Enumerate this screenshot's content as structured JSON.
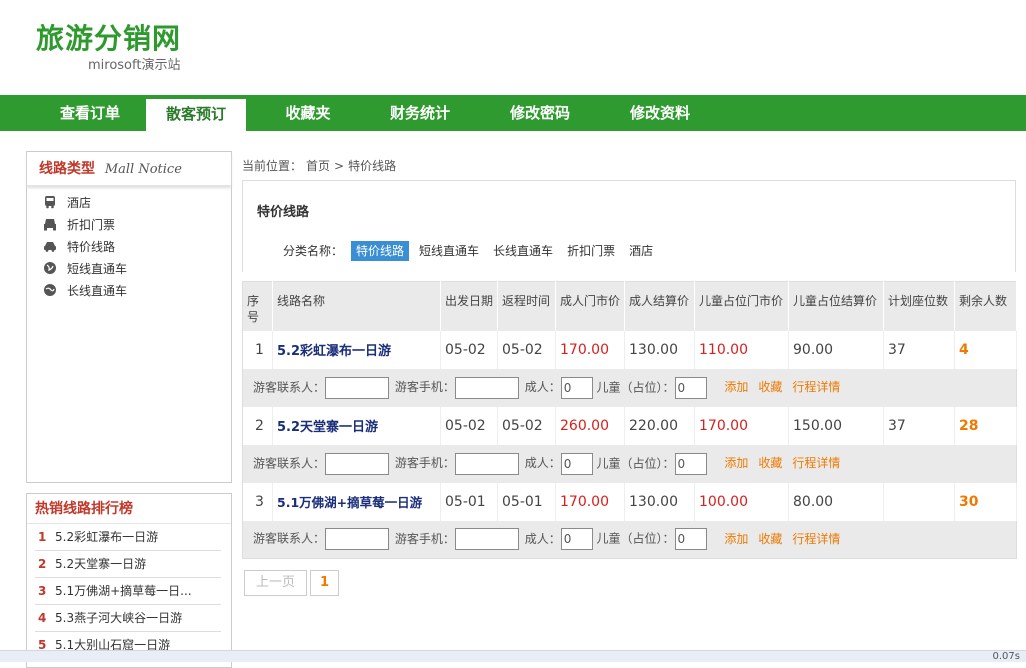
{
  "brand": {
    "title": "旅游分销网",
    "subtitle": "mirosoft演示站"
  },
  "nav": [
    {
      "label": "查看订单"
    },
    {
      "label": "散客预订"
    },
    {
      "label": "收藏夹"
    },
    {
      "label": "财务统计"
    },
    {
      "label": "修改密码"
    },
    {
      "label": "修改资料"
    }
  ],
  "sidebar": {
    "title": "线路类型",
    "title_en": "Mall Notice",
    "categories": [
      {
        "label": "酒店",
        "icon": "bus-icon"
      },
      {
        "label": "折扣门票",
        "icon": "car-icon"
      },
      {
        "label": "特价线路",
        "icon": "car-front-icon"
      },
      {
        "label": "短线直通车",
        "icon": "globe-icon"
      },
      {
        "label": "长线直通车",
        "icon": "globe-icon"
      }
    ],
    "rank_title": "热销线路排行榜",
    "ranking": [
      {
        "n": "1",
        "label": "5.2彩虹瀑布一日游"
      },
      {
        "n": "2",
        "label": "5.2天堂寨一日游"
      },
      {
        "n": "3",
        "label": "5.1万佛湖+摘草莓一日..."
      },
      {
        "n": "4",
        "label": "5.3燕子河大峡谷一日游"
      },
      {
        "n": "5",
        "label": "5.1大别山石窟一日游"
      }
    ]
  },
  "breadcrumb": {
    "prefix": "当前位置：",
    "home": "首页",
    "sep": ">",
    "current": "特价线路"
  },
  "main": {
    "title": "特价线路",
    "filter_label": "分类名称：",
    "filters": [
      "特价线路",
      "短线直通车",
      "长线直通车",
      "折扣门票",
      "酒店"
    ]
  },
  "table": {
    "headers": [
      "序号",
      "线路名称",
      "出发日期",
      "返程时间",
      "成人门市价",
      "成人结算价",
      "儿童占位门市价",
      "儿童占位结算价",
      "计划座位数",
      "剩余人数"
    ],
    "rows": [
      {
        "no": "1",
        "name": "5.2彩虹瀑布一日游",
        "depart": "05-02",
        "return": "05-02",
        "adult_market": "170.00",
        "adult_settle": "130.00",
        "child_market": "110.00",
        "child_settle": "90.00",
        "seats": "37",
        "remain": "4"
      },
      {
        "no": "2",
        "name": "5.2天堂寨一日游",
        "depart": "05-02",
        "return": "05-02",
        "adult_market": "260.00",
        "adult_settle": "220.00",
        "child_market": "170.00",
        "child_settle": "150.00",
        "seats": "37",
        "remain": "28"
      },
      {
        "no": "3",
        "name": "5.1万佛湖+摘草莓一日游",
        "depart": "05-01",
        "return": "05-01",
        "adult_market": "170.00",
        "adult_settle": "130.00",
        "child_market": "100.00",
        "child_settle": "80.00",
        "seats": "",
        "remain": "30"
      }
    ],
    "form": {
      "contact_label": "游客联系人：",
      "phone_label": "游客手机：",
      "adult_label": "成人：",
      "child_label": "儿童（占位）：",
      "adult_value": "0",
      "child_value": "0",
      "add": "添加",
      "fav": "收藏",
      "detail": "行程详情"
    }
  },
  "pager": {
    "prev": "上一页",
    "current": "1"
  },
  "status": {
    "zoom": "0.07s"
  },
  "colors": {
    "brand_green": "#2f9a2f",
    "price_red": "#d91e1e",
    "accent_orange": "#ee7a00",
    "filter_blue": "#3a8fd4"
  }
}
